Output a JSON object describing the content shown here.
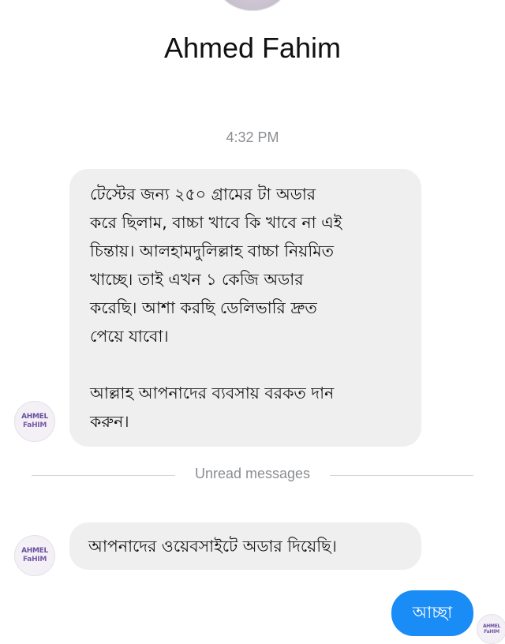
{
  "header": {
    "contact_name": "Ahmed Fahim"
  },
  "thread": {
    "timestamp": "4:32 PM",
    "unread_divider": "Unread messages"
  },
  "avatar": {
    "line1": "AHMEL",
    "line2": "FaHIM"
  },
  "messages": [
    {
      "direction": "incoming",
      "text": "টেস্টের জন্য ২৫০ গ্রামের টা অডার\nকরে ছিলাম, বাচ্চা খাবে কি খাবে না এই\nচিন্তায়। আলহামদুলিল্লাহ বাচ্চা নিয়মিত\nখাচ্ছে। তাই এখন ১ কেজি অডার\nকরেছি। আশা করছি ডেলিভারি দ্রুত\nপেয়ে যাবো।\n\nআল্লাহ আপনাদের ব্যবসায় বরকত দান\nকরুন।"
    },
    {
      "direction": "incoming",
      "text": "আপনাদের ওয়েবসাইটে অডার দিয়েছি।"
    },
    {
      "direction": "outgoing",
      "text": "আচ্ছা"
    }
  ],
  "colors": {
    "incoming_bubble": "#efeff0",
    "outgoing_bubble": "#1a8cf5",
    "meta_text": "#8a8d91"
  }
}
